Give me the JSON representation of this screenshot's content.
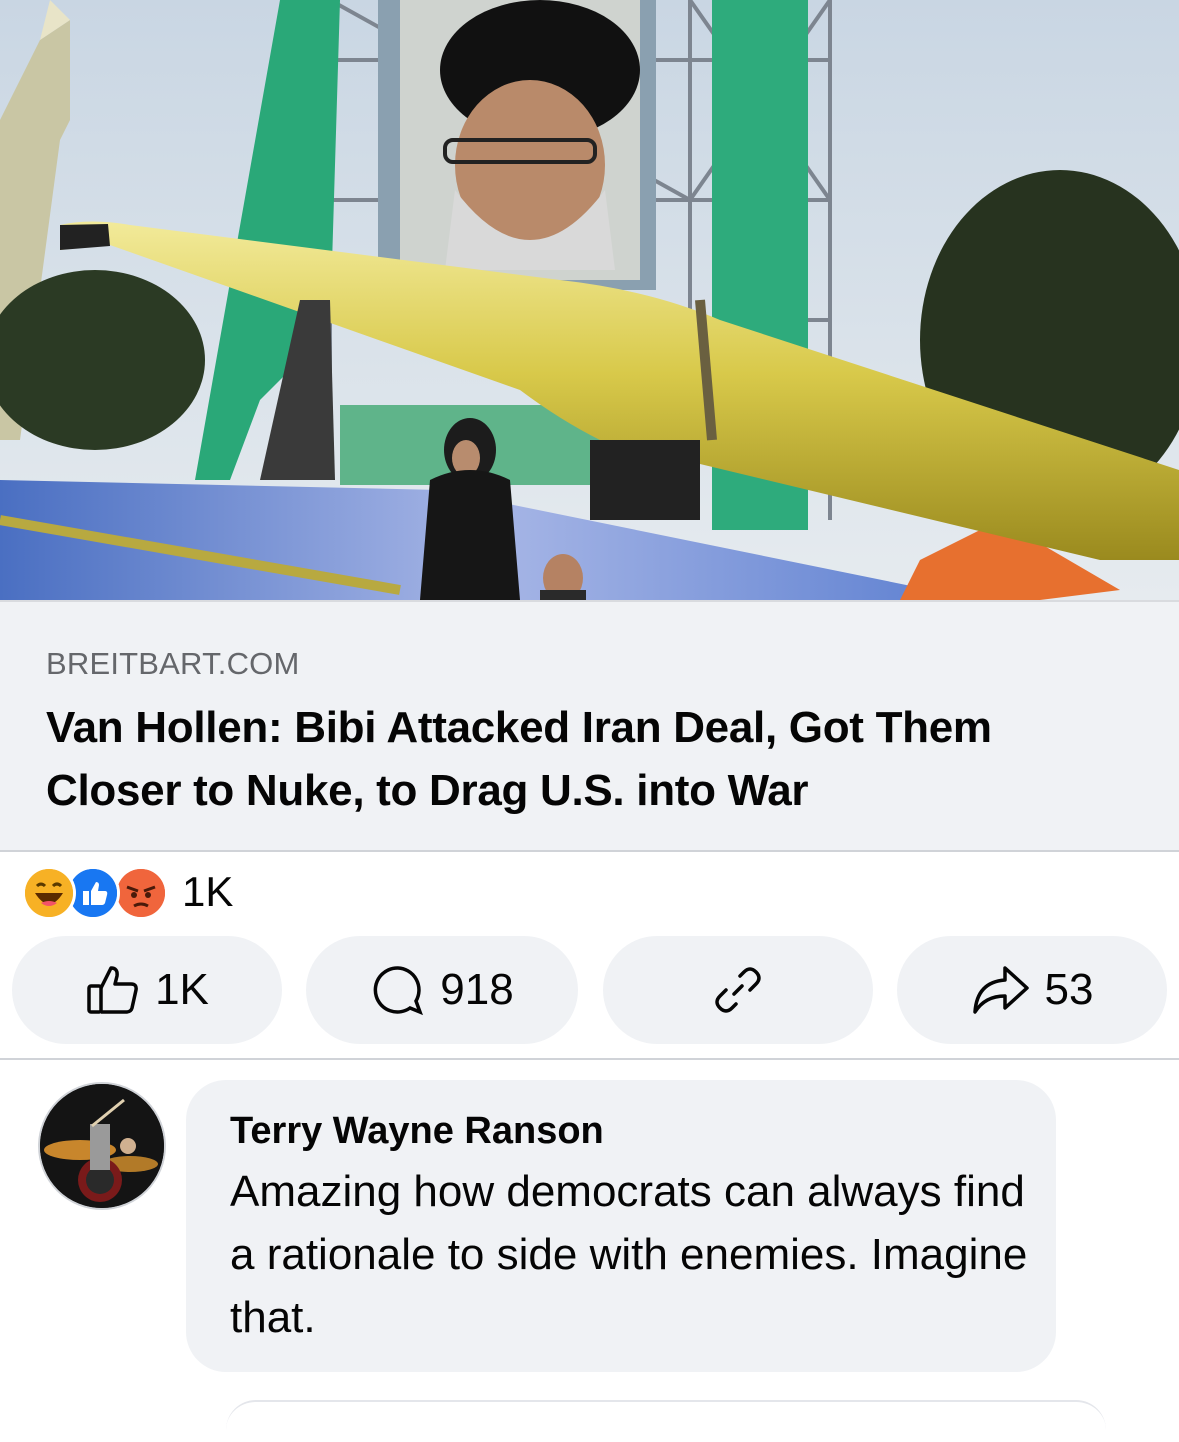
{
  "article": {
    "image_alt_icon": "missile-display-photo",
    "domain": "BREITBART.COM",
    "headline": "Van Hollen: Bibi Attacked Iran Deal, Got Them Closer to Nuke, to Drag U.S. into War"
  },
  "reactions": {
    "icons": [
      "haha-icon",
      "like-icon",
      "angry-icon"
    ],
    "count": "1K"
  },
  "actions": {
    "like_count": "1K",
    "comment_count": "918",
    "share_count": "53"
  },
  "comment": {
    "author": "Terry Wayne Ranson",
    "text": "Amazing how democrats can always find a rationale to side with enemies. Imagine that."
  },
  "colors": {
    "card_bg": "#f0f2f5",
    "secondary_text": "#65676b",
    "like_blue": "#1877f2",
    "angry_orange": "#f0653c",
    "haha_yellow": "#f7b125"
  }
}
